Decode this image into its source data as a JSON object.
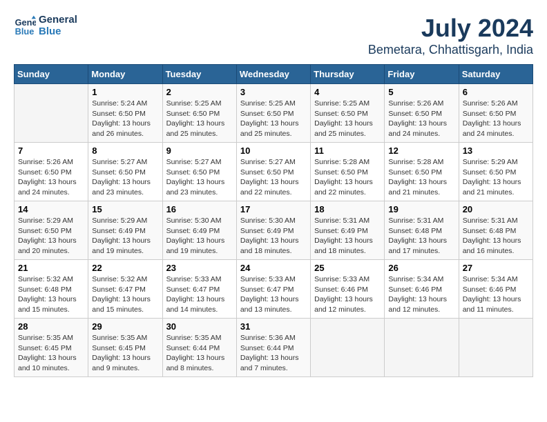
{
  "header": {
    "logo_line1": "General",
    "logo_line2": "Blue",
    "title": "July 2024",
    "subtitle": "Bemetara, Chhattisgarh, India"
  },
  "calendar": {
    "columns": [
      "Sunday",
      "Monday",
      "Tuesday",
      "Wednesday",
      "Thursday",
      "Friday",
      "Saturday"
    ],
    "weeks": [
      [
        {
          "day": "",
          "info": ""
        },
        {
          "day": "1",
          "info": "Sunrise: 5:24 AM\nSunset: 6:50 PM\nDaylight: 13 hours and 26 minutes."
        },
        {
          "day": "2",
          "info": "Sunrise: 5:25 AM\nSunset: 6:50 PM\nDaylight: 13 hours and 25 minutes."
        },
        {
          "day": "3",
          "info": "Sunrise: 5:25 AM\nSunset: 6:50 PM\nDaylight: 13 hours and 25 minutes."
        },
        {
          "day": "4",
          "info": "Sunrise: 5:25 AM\nSunset: 6:50 PM\nDaylight: 13 hours and 25 minutes."
        },
        {
          "day": "5",
          "info": "Sunrise: 5:26 AM\nSunset: 6:50 PM\nDaylight: 13 hours and 24 minutes."
        },
        {
          "day": "6",
          "info": "Sunrise: 5:26 AM\nSunset: 6:50 PM\nDaylight: 13 hours and 24 minutes."
        }
      ],
      [
        {
          "day": "7",
          "info": "Sunrise: 5:26 AM\nSunset: 6:50 PM\nDaylight: 13 hours and 24 minutes."
        },
        {
          "day": "8",
          "info": "Sunrise: 5:27 AM\nSunset: 6:50 PM\nDaylight: 13 hours and 23 minutes."
        },
        {
          "day": "9",
          "info": "Sunrise: 5:27 AM\nSunset: 6:50 PM\nDaylight: 13 hours and 23 minutes."
        },
        {
          "day": "10",
          "info": "Sunrise: 5:27 AM\nSunset: 6:50 PM\nDaylight: 13 hours and 22 minutes."
        },
        {
          "day": "11",
          "info": "Sunrise: 5:28 AM\nSunset: 6:50 PM\nDaylight: 13 hours and 22 minutes."
        },
        {
          "day": "12",
          "info": "Sunrise: 5:28 AM\nSunset: 6:50 PM\nDaylight: 13 hours and 21 minutes."
        },
        {
          "day": "13",
          "info": "Sunrise: 5:29 AM\nSunset: 6:50 PM\nDaylight: 13 hours and 21 minutes."
        }
      ],
      [
        {
          "day": "14",
          "info": "Sunrise: 5:29 AM\nSunset: 6:50 PM\nDaylight: 13 hours and 20 minutes."
        },
        {
          "day": "15",
          "info": "Sunrise: 5:29 AM\nSunset: 6:49 PM\nDaylight: 13 hours and 19 minutes."
        },
        {
          "day": "16",
          "info": "Sunrise: 5:30 AM\nSunset: 6:49 PM\nDaylight: 13 hours and 19 minutes."
        },
        {
          "day": "17",
          "info": "Sunrise: 5:30 AM\nSunset: 6:49 PM\nDaylight: 13 hours and 18 minutes."
        },
        {
          "day": "18",
          "info": "Sunrise: 5:31 AM\nSunset: 6:49 PM\nDaylight: 13 hours and 18 minutes."
        },
        {
          "day": "19",
          "info": "Sunrise: 5:31 AM\nSunset: 6:48 PM\nDaylight: 13 hours and 17 minutes."
        },
        {
          "day": "20",
          "info": "Sunrise: 5:31 AM\nSunset: 6:48 PM\nDaylight: 13 hours and 16 minutes."
        }
      ],
      [
        {
          "day": "21",
          "info": "Sunrise: 5:32 AM\nSunset: 6:48 PM\nDaylight: 13 hours and 15 minutes."
        },
        {
          "day": "22",
          "info": "Sunrise: 5:32 AM\nSunset: 6:47 PM\nDaylight: 13 hours and 15 minutes."
        },
        {
          "day": "23",
          "info": "Sunrise: 5:33 AM\nSunset: 6:47 PM\nDaylight: 13 hours and 14 minutes."
        },
        {
          "day": "24",
          "info": "Sunrise: 5:33 AM\nSunset: 6:47 PM\nDaylight: 13 hours and 13 minutes."
        },
        {
          "day": "25",
          "info": "Sunrise: 5:33 AM\nSunset: 6:46 PM\nDaylight: 13 hours and 12 minutes."
        },
        {
          "day": "26",
          "info": "Sunrise: 5:34 AM\nSunset: 6:46 PM\nDaylight: 13 hours and 12 minutes."
        },
        {
          "day": "27",
          "info": "Sunrise: 5:34 AM\nSunset: 6:46 PM\nDaylight: 13 hours and 11 minutes."
        }
      ],
      [
        {
          "day": "28",
          "info": "Sunrise: 5:35 AM\nSunset: 6:45 PM\nDaylight: 13 hours and 10 minutes."
        },
        {
          "day": "29",
          "info": "Sunrise: 5:35 AM\nSunset: 6:45 PM\nDaylight: 13 hours and 9 minutes."
        },
        {
          "day": "30",
          "info": "Sunrise: 5:35 AM\nSunset: 6:44 PM\nDaylight: 13 hours and 8 minutes."
        },
        {
          "day": "31",
          "info": "Sunrise: 5:36 AM\nSunset: 6:44 PM\nDaylight: 13 hours and 7 minutes."
        },
        {
          "day": "",
          "info": ""
        },
        {
          "day": "",
          "info": ""
        },
        {
          "day": "",
          "info": ""
        }
      ]
    ]
  }
}
